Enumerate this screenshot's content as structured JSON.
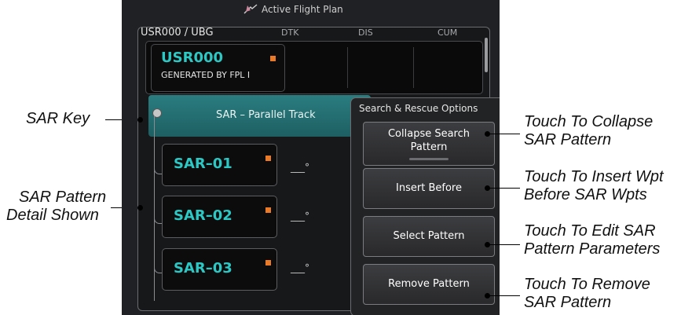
{
  "screen": {
    "title": "Active Flight Plan",
    "route": "USR000 / UBG",
    "columns": [
      "DTK",
      "DIS",
      "CUM"
    ]
  },
  "waypoint": {
    "id": "USR000",
    "subtitle": "GENERATED BY FPL I"
  },
  "sar_key": {
    "label": "SAR – Parallel Track"
  },
  "sar_waypoints": [
    {
      "id": "SAR–01",
      "dtk": "___°"
    },
    {
      "id": "SAR–02",
      "dtk": "___°"
    },
    {
      "id": "SAR–03",
      "dtk": "___°"
    }
  ],
  "popup": {
    "title": "Search & Rescue Options",
    "buttons": {
      "collapse": "Collapse Search Pattern",
      "insert": "Insert Before",
      "select": "Select Pattern",
      "remove": "Remove Pattern"
    }
  },
  "callouts": {
    "sar_key": "SAR Key",
    "pattern_detail_1": "SAR Pattern",
    "pattern_detail_2": "Detail Shown",
    "collapse_1": "Touch To Collapse",
    "collapse_2": "SAR Pattern",
    "insert_1": "Touch To Insert Wpt",
    "insert_2": "Before SAR Wpts",
    "edit_1": "Touch To Edit SAR",
    "edit_2": "Pattern Parameters",
    "remove_1": "Touch To Remove",
    "remove_2": "SAR Pattern"
  },
  "colors": {
    "accent_cyan": "#2dc7c4",
    "sar_row": "#2a7d80",
    "marker_orange": "#e87a28"
  }
}
